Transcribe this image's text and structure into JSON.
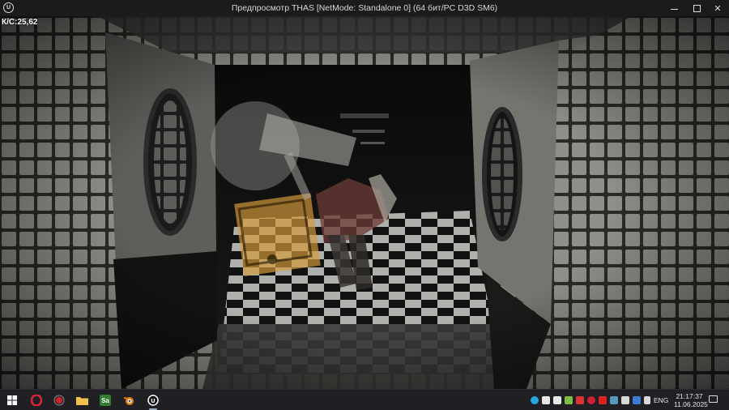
{
  "window": {
    "title": "Предпросмотр THAS [NetMode: Standalone 0]  (64 бит/PC D3D SM6)",
    "logo_text": "U"
  },
  "viewport": {
    "fps_label": "К/С:25,62"
  },
  "taskbar": {
    "language": "ENG",
    "time": "21:17:37",
    "date": "11.06.2025",
    "apps": [
      {
        "name": "start-menu",
        "icon": "windows-logo-icon"
      },
      {
        "name": "opera",
        "icon": "opera-icon",
        "color": "#e0233a"
      },
      {
        "name": "recorder",
        "icon": "record-icon",
        "color": "#d3202a"
      },
      {
        "name": "file-explorer",
        "icon": "folder-icon",
        "color": "#f2c14b"
      },
      {
        "name": "sai",
        "icon": "sai-icon",
        "label": "Sa",
        "color": "#2f7d2f"
      },
      {
        "name": "blender",
        "icon": "blender-icon",
        "color": "#e87d0d"
      },
      {
        "name": "unreal-engine",
        "icon": "unreal-icon",
        "color": "#ffffff"
      }
    ],
    "tray_colors": [
      "#27a7e0",
      "#e8e8e8",
      "#e8e8e8",
      "#7fbf3f",
      "#d33",
      "#cc2233",
      "#d22",
      "#59b",
      "#d9d9d9",
      "#d9d9d9",
      "#3a7bd5",
      "#d9d9d9"
    ]
  }
}
